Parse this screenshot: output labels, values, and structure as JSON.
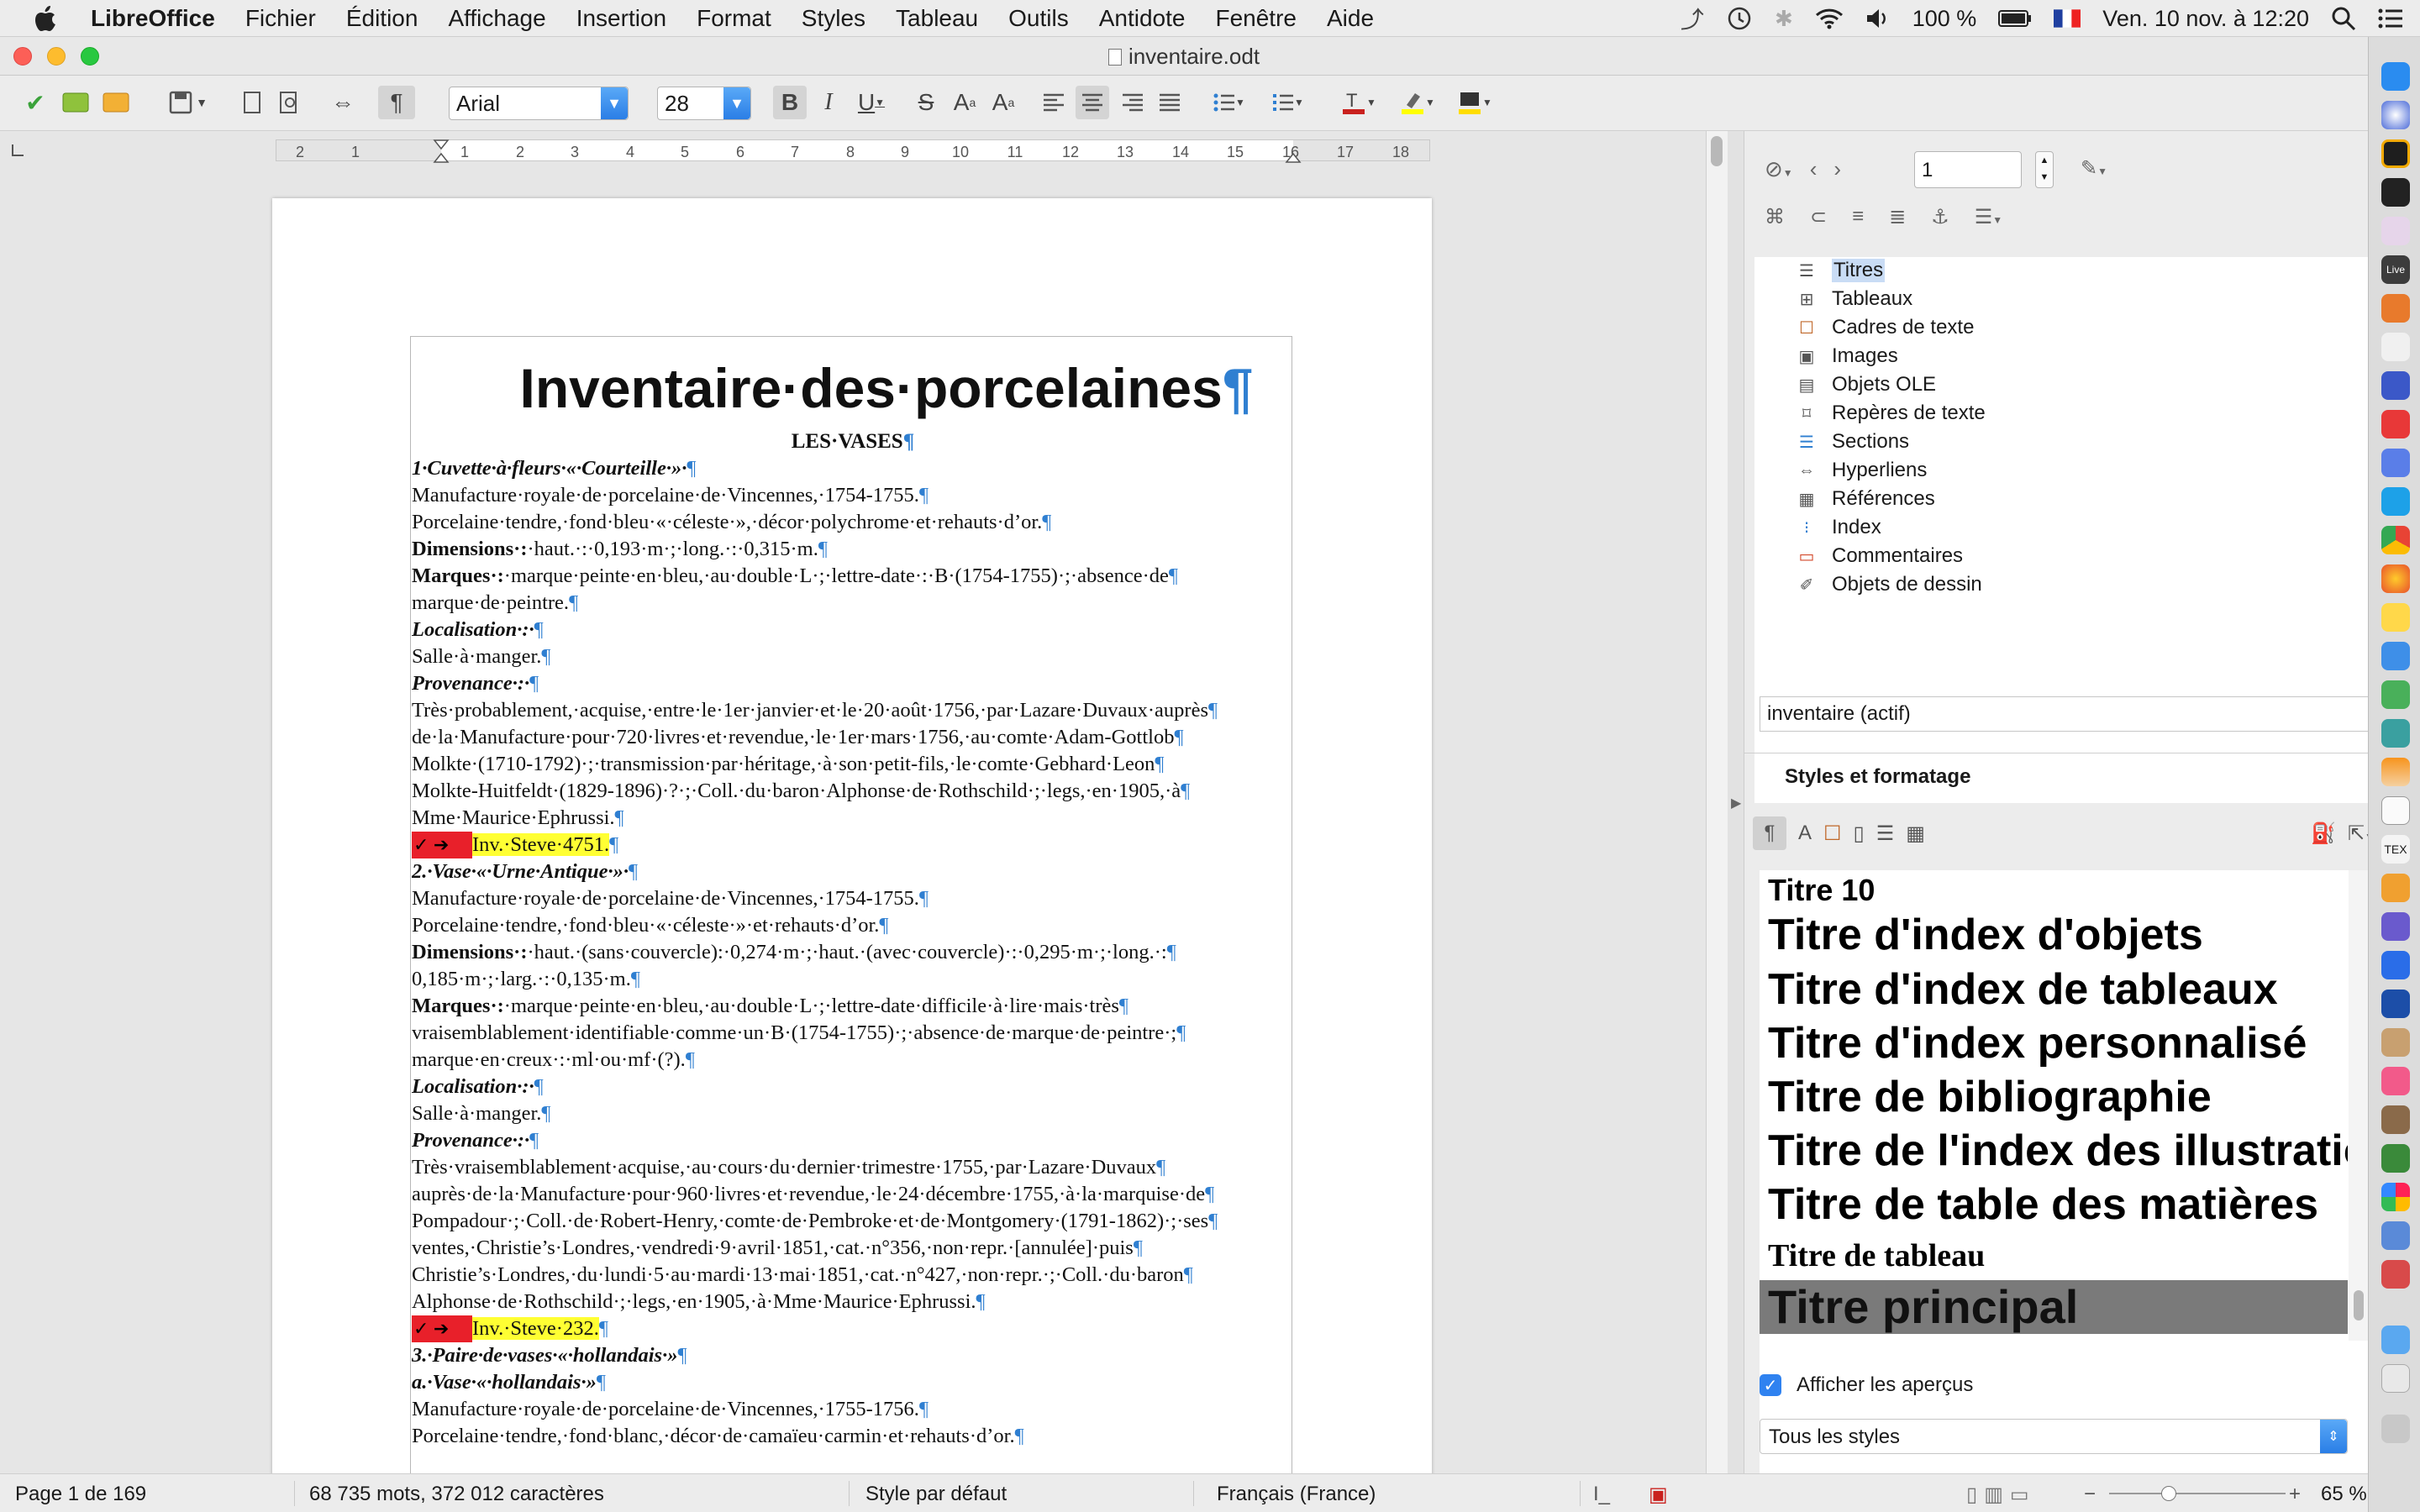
{
  "menubar": {
    "app_name": "LibreOffice",
    "items": [
      "Fichier",
      "Édition",
      "Affichage",
      "Insertion",
      "Format",
      "Styles",
      "Tableau",
      "Outils",
      "Antidote",
      "Fenêtre",
      "Aide"
    ],
    "battery": "100 %",
    "datetime": "Ven. 10 nov. à 12:20"
  },
  "window": {
    "title": "inventaire.odt"
  },
  "toolbar": {
    "font_name": "Arial",
    "font_size": "28"
  },
  "ruler": {
    "ticks": [
      "2",
      "1",
      "1",
      "2",
      "3",
      "4",
      "5",
      "6",
      "7",
      "8",
      "9",
      "10",
      "11",
      "12",
      "13",
      "14",
      "15",
      "16",
      "17",
      "18"
    ]
  },
  "document": {
    "title": "Inventaire·des·porcelaines",
    "subtitle": "LES·VASES",
    "lines": [
      {
        "cls": "bi",
        "text": "1·Cuvette·à·fleurs·«·Courteille·»·"
      },
      {
        "cls": "",
        "text": "Manufacture·royale·de·porcelaine·de·Vincennes,·1754-1755."
      },
      {
        "cls": "",
        "text": "Porcelaine·tendre,·fond·bleu·«·céleste·»,·décor·polychrome·et·rehauts·d’or."
      },
      {
        "cls": "",
        "label": "Dimensions·:",
        "text": "·haut.·:·0,193·m·;·long.·:·0,315·m."
      },
      {
        "cls": "just",
        "label": "Marques·:",
        "text": "·marque·peinte·en·bleu,·au·double·L·;·lettre-date·:·B·(1754-1755)·;·absence·de"
      },
      {
        "cls": "",
        "text": "marque·de·peintre."
      },
      {
        "cls": "bi",
        "text": "Localisation·:·"
      },
      {
        "cls": "",
        "text": "Salle·à·manger."
      },
      {
        "cls": "bi",
        "text": "Provenance·:·"
      },
      {
        "cls": "just",
        "text": "Très·probablement,·acquise,·entre·le·1er·janvier·et·le·20·août·1756,·par·Lazare·Duvaux·auprès"
      },
      {
        "cls": "just",
        "text": "de·la·Manufacture·pour·720·livres·et·revendue,·le·1er·mars·1756,·au·comte·Adam-Gottlob"
      },
      {
        "cls": "just",
        "text": "Molkte·(1710-1792)·;·transmission·par·héritage,·à·son·petit-fils,·le·comte·Gebhard·Leon"
      },
      {
        "cls": "just",
        "text": "Molkte-Huitfeldt·(1829-1896)·?·;·Coll.·du·baron·Alphonse·de·Rothschild·;·legs,·en·1905,·à"
      },
      {
        "cls": "",
        "text": "Mme·Maurice·Ephrussi."
      },
      {
        "cls": "inv",
        "text": "Inv.·Steve·4751."
      },
      {
        "cls": "bi",
        "text": "2.·Vase·«·Urne·Antique·»·"
      },
      {
        "cls": "",
        "text": "Manufacture·royale·de·porcelaine·de·Vincennes,·1754-1755."
      },
      {
        "cls": "",
        "text": "Porcelaine·tendre,·fond·bleu·«·céleste·»·et·rehauts·d’or."
      },
      {
        "cls": "just",
        "label": "Dimensions·:",
        "text": "·haut.·(sans·couvercle):·0,274·m·;·haut.·(avec·couvercle)·:·0,295·m·;·long.·:"
      },
      {
        "cls": "",
        "text": "0,185·m·;·larg.·:·0,135·m."
      },
      {
        "cls": "just",
        "label": "Marques·:",
        "text": "·marque·peinte·en·bleu,·au·double·L·;·lettre-date·difficile·à·lire·mais·très"
      },
      {
        "cls": "just",
        "text": "vraisemblablement·identifiable·comme·un·B·(1754-1755)·;·absence·de·marque·de·peintre·;"
      },
      {
        "cls": "",
        "text": "marque·en·creux·:·ml·ou·mf·(?)."
      },
      {
        "cls": "bi",
        "text": "Localisation·:·"
      },
      {
        "cls": "",
        "text": "Salle·à·manger."
      },
      {
        "cls": "bi",
        "text": "Provenance·:·"
      },
      {
        "cls": "just",
        "text": "Très·vraisemblablement·acquise,·au·cours·du·dernier·trimestre·1755,·par·Lazare·Duvaux"
      },
      {
        "cls": "just",
        "text": "auprès·de·la·Manufacture·pour·960·livres·et·revendue,·le·24·décembre·1755,·à·la·marquise·de"
      },
      {
        "cls": "just",
        "text": "Pompadour·;·Coll.·de·Robert-Henry,·comte·de·Pembroke·et·de·Montgomery·(1791-1862)·;·ses"
      },
      {
        "cls": "just",
        "text": "ventes,·Christie’s·Londres,·vendredi·9·avril·1851,·cat.·n°356,·non·repr.·[annulée]·puis"
      },
      {
        "cls": "just",
        "text": "Christie’s·Londres,·du·lundi·5·au·mardi·13·mai·1851,·cat.·n°427,·non·repr.·;·Coll.·du·baron"
      },
      {
        "cls": "",
        "text": "Alphonse·de·Rothschild·;·legs,·en·1905,·à·Mme·Maurice·Ephrussi."
      },
      {
        "cls": "inv",
        "text": "Inv.·Steve·232."
      },
      {
        "cls": "bi",
        "text": "3.·Paire·de·vases·«·hollandais·»"
      },
      {
        "cls": "bi",
        "text": "a.·Vase·«·hollandais·»"
      },
      {
        "cls": "",
        "text": "Manufacture·royale·de·porcelaine·de·Vincennes,·1755-1756."
      },
      {
        "cls": "",
        "text": "Porcelaine·tendre,·fond·blanc,·décor·de·camaïeu·carmin·et·rehauts·d’or."
      }
    ]
  },
  "navigator": {
    "page_value": "1",
    "items": [
      "Titres",
      "Tableaux",
      "Cadres de texte",
      "Images",
      "Objets OLE",
      "Repères de texte",
      "Sections",
      "Hyperliens",
      "Références",
      "Index",
      "Commentaires",
      "Objets de dessin"
    ],
    "document_select": "inventaire (actif)"
  },
  "styles_panel": {
    "header": "Styles et formatage",
    "styles": [
      "Titre 10",
      "Titre d'index d'objets",
      "Titre d'index de tableaux",
      "Titre d'index personnalisé",
      "Titre de bibliographie",
      "Titre de l'index des illustrations",
      "Titre de table des matières",
      "Titre de tableau",
      "Titre principal"
    ],
    "show_previews_label": "Afficher les aperçus",
    "filter": "Tous les styles"
  },
  "statusbar": {
    "page": "Page 1 de 169",
    "words": "68 735 mots, 372 012 caractères",
    "page_style": "Style par défaut",
    "language": "Français (France)",
    "zoom": "65 %"
  },
  "colors": {
    "accent": "#2f82f0",
    "highlight": "#ffff33",
    "marker_red": "#e8202a",
    "pilcrow": "#2f7fd1"
  }
}
